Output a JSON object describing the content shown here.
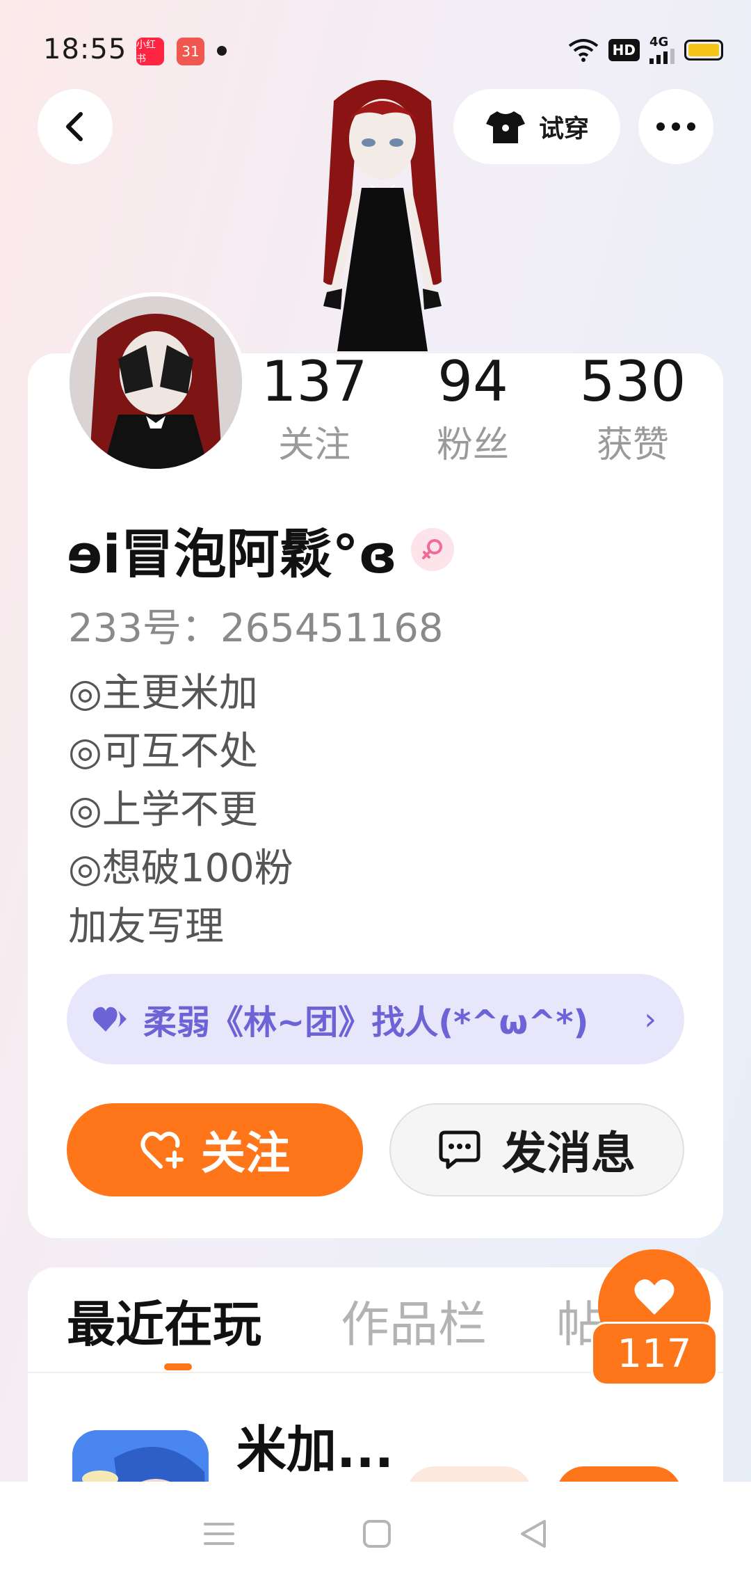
{
  "status_bar": {
    "time": "18:55",
    "app_badge_1": "小红书",
    "app_badge_2": "31",
    "hd": "HD",
    "network": "4G"
  },
  "header": {
    "try_on_label": "试穿"
  },
  "stats": [
    {
      "value": "137",
      "label": "关注"
    },
    {
      "value": "94",
      "label": "粉丝"
    },
    {
      "value": "530",
      "label": "获赞"
    }
  ],
  "profile": {
    "nickname": "ɘi冒泡阿鬏°ɞ",
    "account_id": "233号：265451168",
    "bio": [
      "◎主更米加",
      "◎可互不处",
      "◎上学不更",
      "◎想破100粉",
      "加友写理"
    ]
  },
  "group_banner": {
    "text": "柔弱《林~团》找人(*^ω^*)",
    "chevron": "›"
  },
  "actions": {
    "follow_label": "关注",
    "message_label": "发消息"
  },
  "tabs": [
    "最近在玩",
    "作品栏",
    "帖"
  ],
  "recent_game": {
    "title": "米加..."
  },
  "floating_like": {
    "count": "117"
  },
  "colors": {
    "accent": "#ff7519",
    "banner_bg": "#e8e6fb",
    "banner_text": "#6c63d6"
  }
}
